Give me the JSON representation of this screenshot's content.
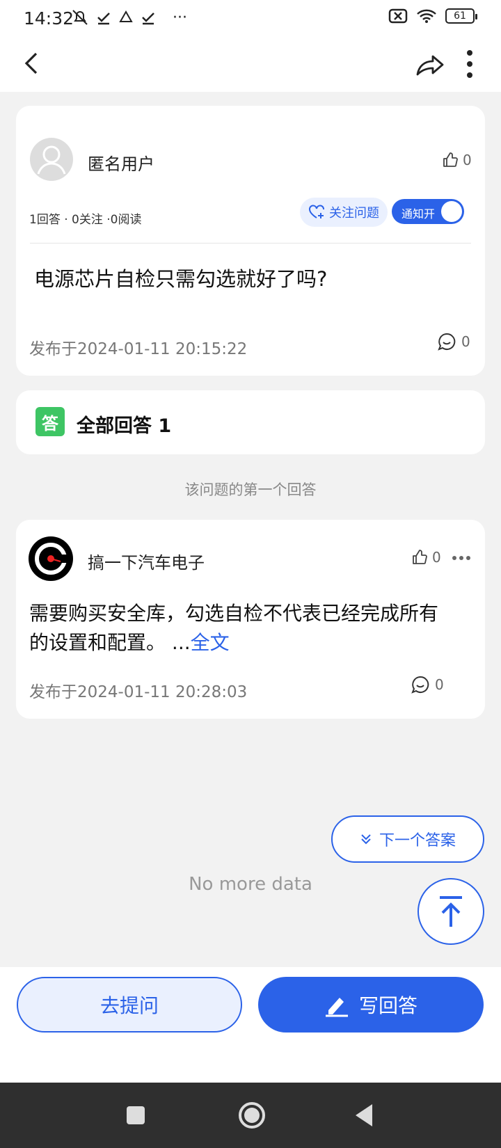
{
  "status_bar": {
    "time": "14:32",
    "more": "···",
    "battery": "61"
  },
  "question": {
    "author": "匿名用户",
    "likes": "0",
    "stats": "1回答 · 0关注 ·0阅读",
    "follow_label": "关注问题",
    "notify_label": "通知开",
    "title": "电源芯片自检只需勾选就好了吗?",
    "published": "发布于2024-01-11 20:15:22",
    "comments": "0"
  },
  "answers_header": {
    "badge": "答",
    "title": "全部回答 1"
  },
  "first_answer_hint": "该问题的第一个回答",
  "answer": {
    "author": "搞一下汽车电子",
    "likes": "0",
    "text_line1": "需要购买安全库，勾选自检不代表已经完成所有",
    "text_line2": "的设置和配置。",
    "ellipsis": " ...",
    "full_text_link": "全文",
    "published": "发布于2024-01-11 20:28:03",
    "comments": "0"
  },
  "next_answer_label": "下一个答案",
  "no_more": "No more data",
  "bottom": {
    "ask_label": "去提问",
    "write_label": "写回答"
  },
  "colors": {
    "accent": "#2b62e8",
    "badge_green": "#3ec564",
    "background": "#f2f2f2"
  },
  "icons": [
    "back-icon",
    "share-icon",
    "more-vert-icon",
    "thumb-up-icon",
    "heart-add-icon",
    "comment-icon",
    "more-horiz-icon",
    "double-chevron-down-icon",
    "arrow-up-to-top-icon",
    "pencil-icon"
  ]
}
